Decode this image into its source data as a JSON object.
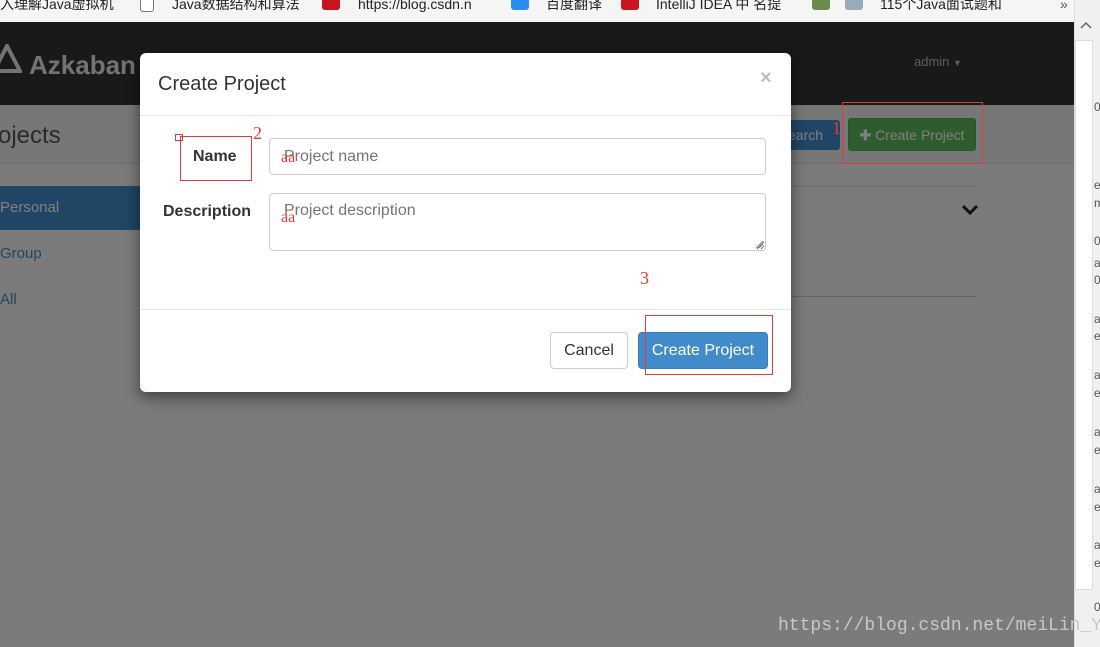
{
  "bookmarks": [
    {
      "label": "入理解Java虚拟机",
      "icon": "none"
    },
    {
      "label": "Java数据结构和算法",
      "icon": "page-icon"
    },
    {
      "label": "https://blog.csdn.n",
      "icon": "csdn-icon"
    },
    {
      "label": "百度翻译",
      "icon": "baidu-translate-icon"
    },
    {
      "label": "IntelliJ IDEA 中 名提",
      "icon": "csdn-icon"
    },
    {
      "label": "115个Java面试题和",
      "icon": "bookmark-icon"
    }
  ],
  "app": {
    "brand": "Azkaban",
    "user": "admin",
    "page_title": "ojects",
    "search_label": "earch",
    "create_label": "Create Project"
  },
  "sidebar": {
    "items": [
      {
        "label": "Personal",
        "active": true
      },
      {
        "label": "Group",
        "active": false
      },
      {
        "label": "All",
        "active": false
      }
    ]
  },
  "modal": {
    "title": "Create Project",
    "close": "×",
    "name_label": "Name",
    "name_placeholder": "Project name",
    "description_label": "Description",
    "description_placeholder": "Project description",
    "cancel_label": "Cancel",
    "submit_label": "Create Project"
  },
  "annotations": {
    "step1": "1",
    "step2": "2",
    "step3": "3",
    "name_mark": "aa",
    "desc_mark": "aa"
  },
  "edge_text": [
    "0",
    "e",
    "m",
    "0",
    "a",
    "0",
    "a",
    "e",
    "a",
    "e",
    "a",
    "e",
    "a",
    "e",
    "a",
    "e",
    "0"
  ],
  "watermark": "https://blog.csdn.net/meiLin_Ya",
  "colors": {
    "navbar": "#333333",
    "primary": "#428bca",
    "success": "#5cb85c",
    "annotation": "#e03a3a"
  }
}
